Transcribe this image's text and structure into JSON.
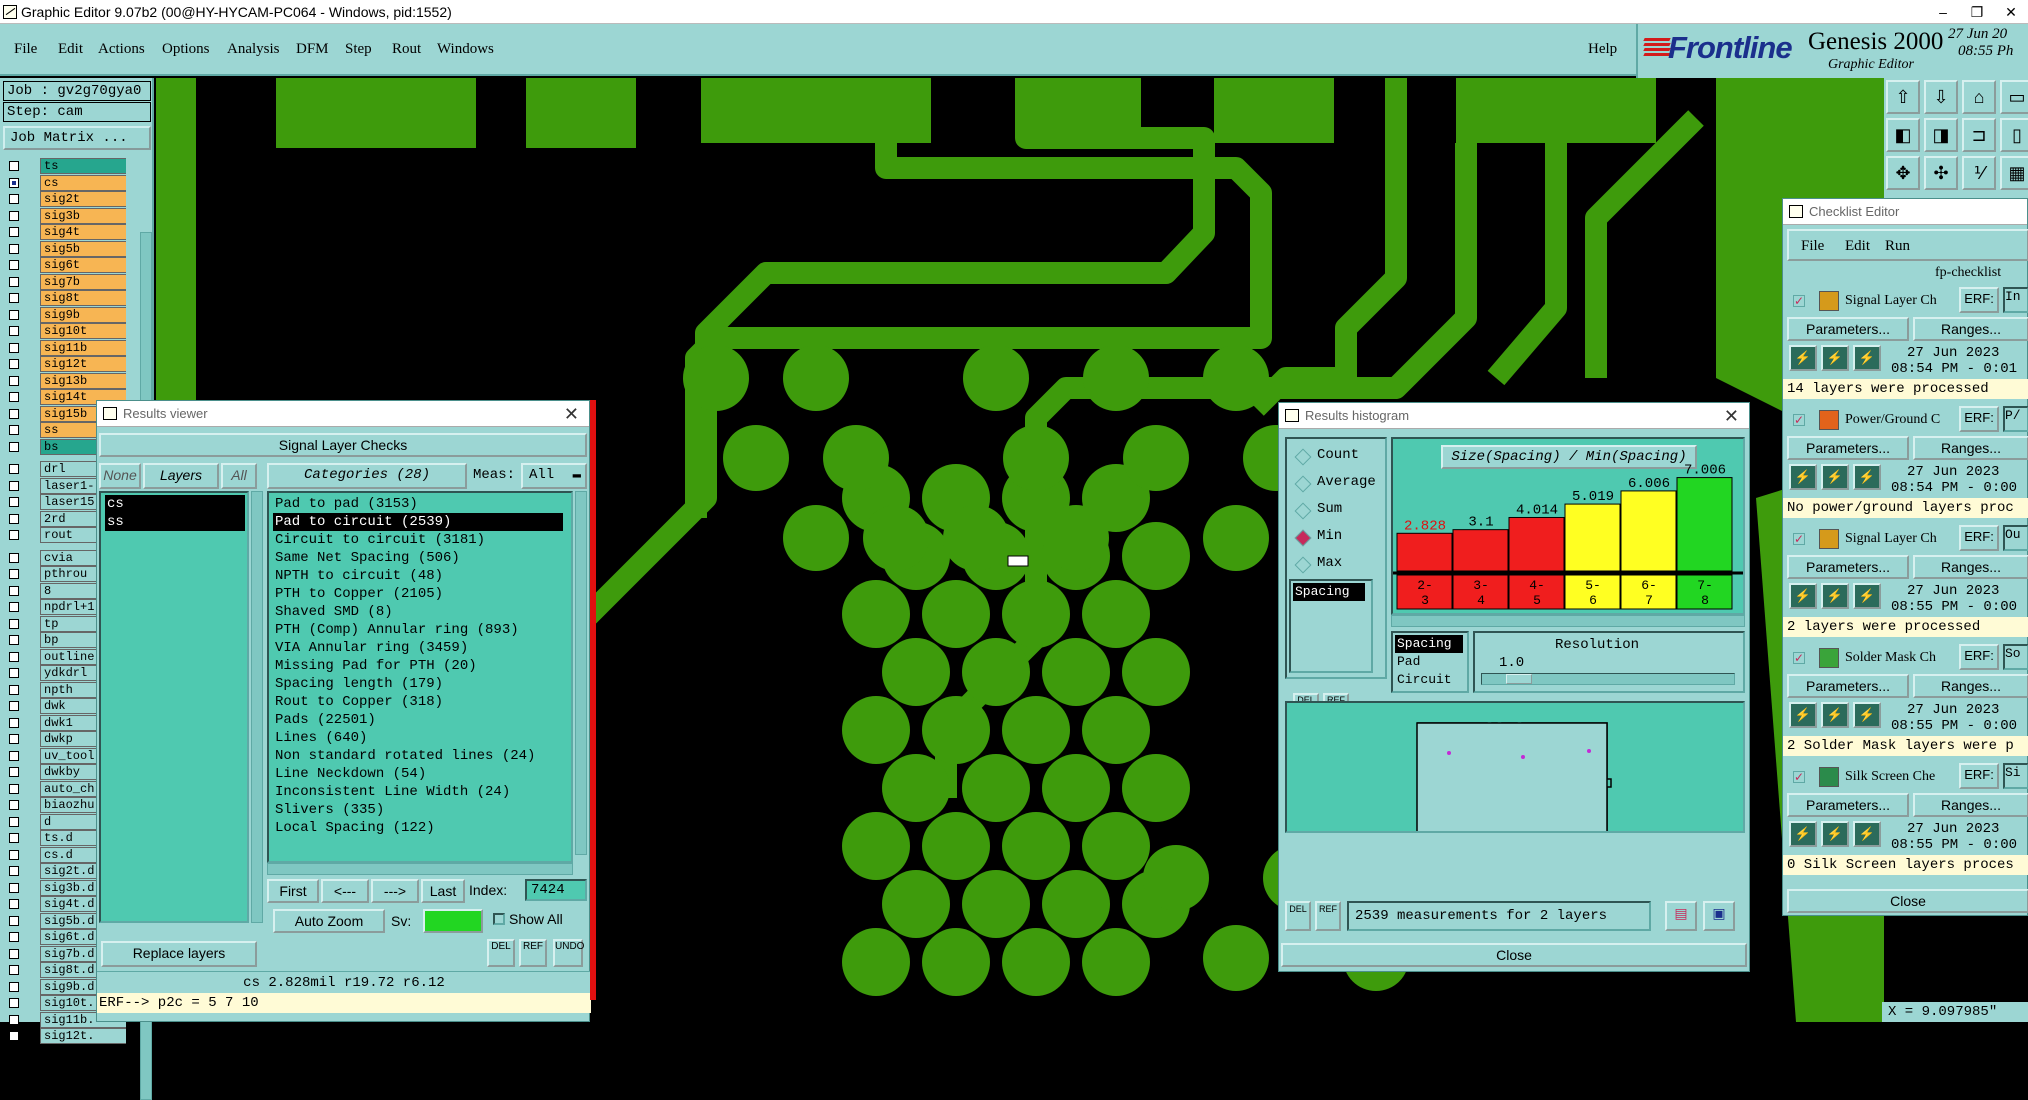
{
  "window": {
    "title": "Graphic Editor 9.07b2 (00@HY-HYCAM-PC064 - Windows, pid:1552)",
    "minimize": "–",
    "restore": "❐",
    "close": "✕"
  },
  "menu": [
    "File",
    "Edit",
    "Actions",
    "Options",
    "Analysis",
    "DFM",
    "Step",
    "Rout",
    "Windows"
  ],
  "help": "Help",
  "logo": {
    "brand": "Frontline",
    "product": "Genesis 2000",
    "subtitle": "Graphic Editor",
    "date": "27 Jun 20",
    "time": "08:55 Ph"
  },
  "left": {
    "job": "Job : gv2g70gya0",
    "step": "Step: cam",
    "job_matrix": "Job Matrix ..."
  },
  "layers": [
    {
      "name": "ts",
      "color": "#26a68e",
      "on": false
    },
    {
      "name": "cs",
      "color": "#f7b553",
      "on": true
    },
    {
      "name": "sig2t",
      "color": "#f7b553",
      "on": false
    },
    {
      "name": "sig3b",
      "color": "#f7b553",
      "on": false
    },
    {
      "name": "sig4t",
      "color": "#f7b553",
      "on": false
    },
    {
      "name": "sig5b",
      "color": "#f7b553",
      "on": false
    },
    {
      "name": "sig6t",
      "color": "#f7b553",
      "on": false
    },
    {
      "name": "sig7b",
      "color": "#f7b553",
      "on": false
    },
    {
      "name": "sig8t",
      "color": "#f7b553",
      "on": false
    },
    {
      "name": "sig9b",
      "color": "#f7b553",
      "on": false
    },
    {
      "name": "sig10t",
      "color": "#f7b553",
      "on": false
    },
    {
      "name": "sig11b",
      "color": "#f7b553",
      "on": false
    },
    {
      "name": "sig12t",
      "color": "#f7b553",
      "on": false
    },
    {
      "name": "sig13b",
      "color": "#f7b553",
      "on": false
    },
    {
      "name": "sig14t",
      "color": "#f7b553",
      "on": false
    },
    {
      "name": "sig15b",
      "color": "#f7b553",
      "on": false
    },
    {
      "name": "ss",
      "color": "#f7b553",
      "on": false
    },
    {
      "name": "bs",
      "color": "#26a68e",
      "on": false
    },
    {
      "name": "drl",
      "color": "#9cd6d3",
      "on": false
    },
    {
      "name": "laser1-",
      "color": "#9cd6d3",
      "on": false
    },
    {
      "name": "laser15",
      "color": "#9cd6d3",
      "on": false
    },
    {
      "name": "2rd",
      "color": "#9cd6d3",
      "on": false
    },
    {
      "name": "rout",
      "color": "#9cd6d3",
      "on": false
    },
    {
      "name": "cvia",
      "color": "#9cd6d3",
      "on": false
    },
    {
      "name": "pthrou",
      "color": "#9cd6d3",
      "on": false
    },
    {
      "name": "8",
      "color": "#9cd6d3",
      "on": false
    },
    {
      "name": "npdrl+1",
      "color": "#9cd6d3",
      "on": false
    },
    {
      "name": "tp",
      "color": "#9cd6d3",
      "on": false
    },
    {
      "name": "bp",
      "color": "#9cd6d3",
      "on": false
    },
    {
      "name": "outline",
      "color": "#9cd6d3",
      "on": false
    },
    {
      "name": "ydkdrl",
      "color": "#9cd6d3",
      "on": false
    },
    {
      "name": "npth",
      "color": "#9cd6d3",
      "on": false
    },
    {
      "name": "dwk",
      "color": "#9cd6d3",
      "on": false
    },
    {
      "name": "dwk1",
      "color": "#9cd6d3",
      "on": false
    },
    {
      "name": "dwkp",
      "color": "#9cd6d3",
      "on": false
    },
    {
      "name": "uv_tool",
      "color": "#9cd6d3",
      "on": false
    },
    {
      "name": "dwkby",
      "color": "#9cd6d3",
      "on": false
    },
    {
      "name": "auto_chl",
      "color": "#9cd6d3",
      "on": false
    },
    {
      "name": "biaozhu",
      "color": "#9cd6d3",
      "on": false
    },
    {
      "name": "d",
      "color": "#9cd6d3",
      "on": false
    },
    {
      "name": "ts.d",
      "color": "#9cd6d3",
      "on": false
    },
    {
      "name": "cs.d",
      "color": "#9cd6d3",
      "on": false
    },
    {
      "name": "sig2t.d",
      "color": "#9cd6d3",
      "on": false
    },
    {
      "name": "sig3b.d",
      "color": "#9cd6d3",
      "on": false
    },
    {
      "name": "sig4t.d",
      "color": "#9cd6d3",
      "on": false
    },
    {
      "name": "sig5b.d",
      "color": "#9cd6d3",
      "on": false
    },
    {
      "name": "sig6t.d",
      "color": "#9cd6d3",
      "on": false
    },
    {
      "name": "sig7b.d",
      "color": "#9cd6d3",
      "on": false
    },
    {
      "name": "sig8t.d",
      "color": "#9cd6d3",
      "on": false
    },
    {
      "name": "sig9b.d",
      "color": "#9cd6d3",
      "on": false
    },
    {
      "name": "sig10t.",
      "color": "#9cd6d3",
      "on": false
    },
    {
      "name": "sig11b.",
      "color": "#9cd6d3",
      "on": false
    },
    {
      "name": "sig12t.",
      "color": "#9cd6d3",
      "on": false
    }
  ],
  "results_viewer": {
    "title": "Results viewer",
    "header": "Signal Layer Checks",
    "none": "None",
    "layers": "Layers",
    "all": "All",
    "categories_label": "Categories (28)",
    "meas_label": "Meas:",
    "meas_value": "All",
    "layer_items": [
      "cs",
      "ss"
    ],
    "categories": [
      "Pad to pad (3153)",
      "Pad to circuit (2539)",
      "Circuit to circuit (3181)",
      "Same Net Spacing (506)",
      "NPTH to circuit (48)",
      "PTH to Copper (2105)",
      "Shaved SMD (8)",
      "PTH (Comp) Annular ring (893)",
      "VIA Annular ring (3459)",
      "Missing Pad for PTH (20)",
      "Spacing length (179)",
      "Rout to Copper (318)",
      "Pads (22501)",
      "Lines (640)",
      "Non standard rotated lines (24)",
      "Line Neckdown (54)",
      "Inconsistent Line Width (24)",
      "Slivers (335)",
      "Local Spacing (122)"
    ],
    "selected_category": 1,
    "first": "First",
    "prev": "<---",
    "next": "--->",
    "last": "Last",
    "index_label": "Index:",
    "index_value": "7424",
    "auto_zoom": "Auto Zoom",
    "sv": "Sv:",
    "show_all": "Show All",
    "replace_layers": "Replace layers",
    "del": "DEL",
    "ref": "REF",
    "undo": "UNDO",
    "status": "cs 2.828mil  r19.72  r6.12",
    "erf": "ERF--> p2c = 5 7 10"
  },
  "histogram": {
    "title": "Results histogram",
    "modes": [
      "Count",
      "Average",
      "Sum",
      "Min",
      "Max"
    ],
    "selected_mode": 3,
    "list_item": "Spacing",
    "chart_title": "Size(Spacing) / Min(Spacing)",
    "bins": [
      {
        "label": "2-3",
        "value": 2.828,
        "color": "#f01e1e"
      },
      {
        "label": "3-4",
        "value": 3.1,
        "color": "#f01e1e"
      },
      {
        "label": "4-5",
        "value": 4.014,
        "color": "#f01e1e"
      },
      {
        "label": "5-6",
        "value": 5.019,
        "color": "#ffff22"
      },
      {
        "label": "6-7",
        "value": 6.006,
        "color": "#ffff22"
      },
      {
        "label": "7-8",
        "value": 7.006,
        "color": "#22d622"
      }
    ],
    "value_labels": [
      "2.828",
      "3.1",
      "4.014",
      "5.019",
      "6.006",
      "7.006"
    ],
    "bin_top": [
      "2-",
      "3-",
      "4-",
      "5-",
      "6-",
      "7-"
    ],
    "bin_bottom": [
      "3",
      "4",
      "5",
      "6",
      "7",
      "8"
    ],
    "group_items": [
      "Spacing",
      "Pad",
      "Circuit"
    ],
    "resolution_label": "Resolution",
    "resolution_value": "1.0",
    "del": "DEL",
    "ref": "REF",
    "status": "2539 measurements for 2 layers",
    "close": "Close"
  },
  "checklist": {
    "title": "Checklist Editor",
    "menu": [
      "File",
      "Edit",
      "Run"
    ],
    "name": "fp-checklist",
    "erf": "ERF:",
    "parameters": "Parameters...",
    "ranges": "Ranges...",
    "items": [
      {
        "name": "Signal Layer Ch",
        "erf_value": "In",
        "date": "27 Jun 2023",
        "time": "08:54 PM - 0:01",
        "msg": "14 layers were processed"
      },
      {
        "name": "Power/Ground C",
        "erf_value": "P/",
        "date": "27 Jun 2023",
        "time": "08:54 PM - 0:00",
        "msg": "No power/ground layers proc"
      },
      {
        "name": "Signal Layer Ch",
        "erf_value": "Ou",
        "date": "27 Jun 2023",
        "time": "08:55 PM - 0:00",
        "msg": "2 layers were processed"
      },
      {
        "name": "Solder Mask Ch",
        "erf_value": "So",
        "date": "27 Jun 2023",
        "time": "08:55 PM - 0:00",
        "msg": "2 Solder Mask layers were p"
      },
      {
        "name": "Silk Screen Che",
        "erf_value": "Si",
        "date": "27 Jun 2023",
        "time": "08:55 PM - 0:00",
        "msg": "0 Silk Screen layers proces"
      }
    ],
    "close": "Close"
  },
  "coord": "X = 9.097985\""
}
